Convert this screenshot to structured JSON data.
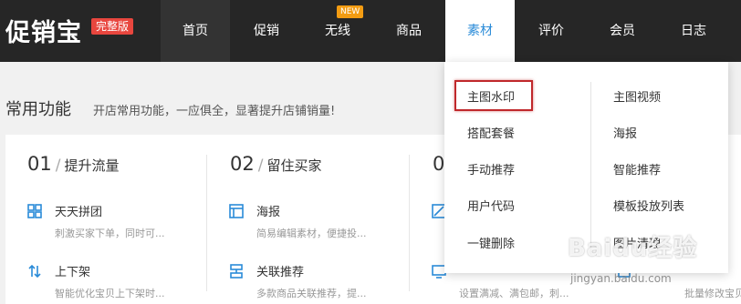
{
  "header": {
    "logo": "促销宝",
    "edition_badge": "完整版",
    "nav": [
      "首页",
      "促销",
      "无线",
      "商品",
      "素材",
      "评价",
      "会员",
      "日志"
    ],
    "new_badge": "NEW",
    "active_nav": "素材"
  },
  "section": {
    "title": "常用功能",
    "subtitle": "开店常用功能，一应俱全，显著提升店铺销量!"
  },
  "columns": [
    {
      "num": "01",
      "slash": "/",
      "name": "提升流量",
      "features": [
        {
          "title": "天天拼团",
          "desc": "刺激买家下单，同时可...",
          "icon": "grid-icon"
        },
        {
          "title": "上下架",
          "desc": "智能优化宝贝上下架时...",
          "icon": "updown-arrows-icon"
        }
      ]
    },
    {
      "num": "02",
      "slash": "/",
      "name": "留住买家",
      "features": [
        {
          "title": "海报",
          "desc": "简易编辑素材，便捷投...",
          "icon": "poster-layout-icon"
        },
        {
          "title": "关联推荐",
          "desc": "多款商品关联推荐，提...",
          "icon": "related-icon"
        }
      ]
    },
    {
      "num": "0",
      "features": [
        {
          "title": "",
          "desc": "",
          "icon": "edit-icon"
        },
        {
          "title": "",
          "desc": "设置满减、满包邮，刺...",
          "icon": "monitor-icon"
        }
      ]
    },
    {
      "features": [
        {
          "title": "",
          "desc": "批量修改宝贝的...",
          "icon": "batch-icon"
        }
      ]
    }
  ],
  "dropdown": {
    "left_items": [
      "主图水印",
      "搭配套餐",
      "手动推荐",
      "用户代码",
      "一键删除"
    ],
    "right_items": [
      "主图视频",
      "海报",
      "智能推荐",
      "模板投放列表",
      "图片清理"
    ],
    "highlighted_item": "主图水印"
  },
  "watermark": {
    "logo": "Baidu经验",
    "url": "jingyan.baidu.com"
  },
  "colors": {
    "topbar": "#262626",
    "accent_blue": "#2a8bd8",
    "badge_red": "#e8463e",
    "badge_orange": "#f39c12",
    "highlight_border": "#c0282b"
  }
}
